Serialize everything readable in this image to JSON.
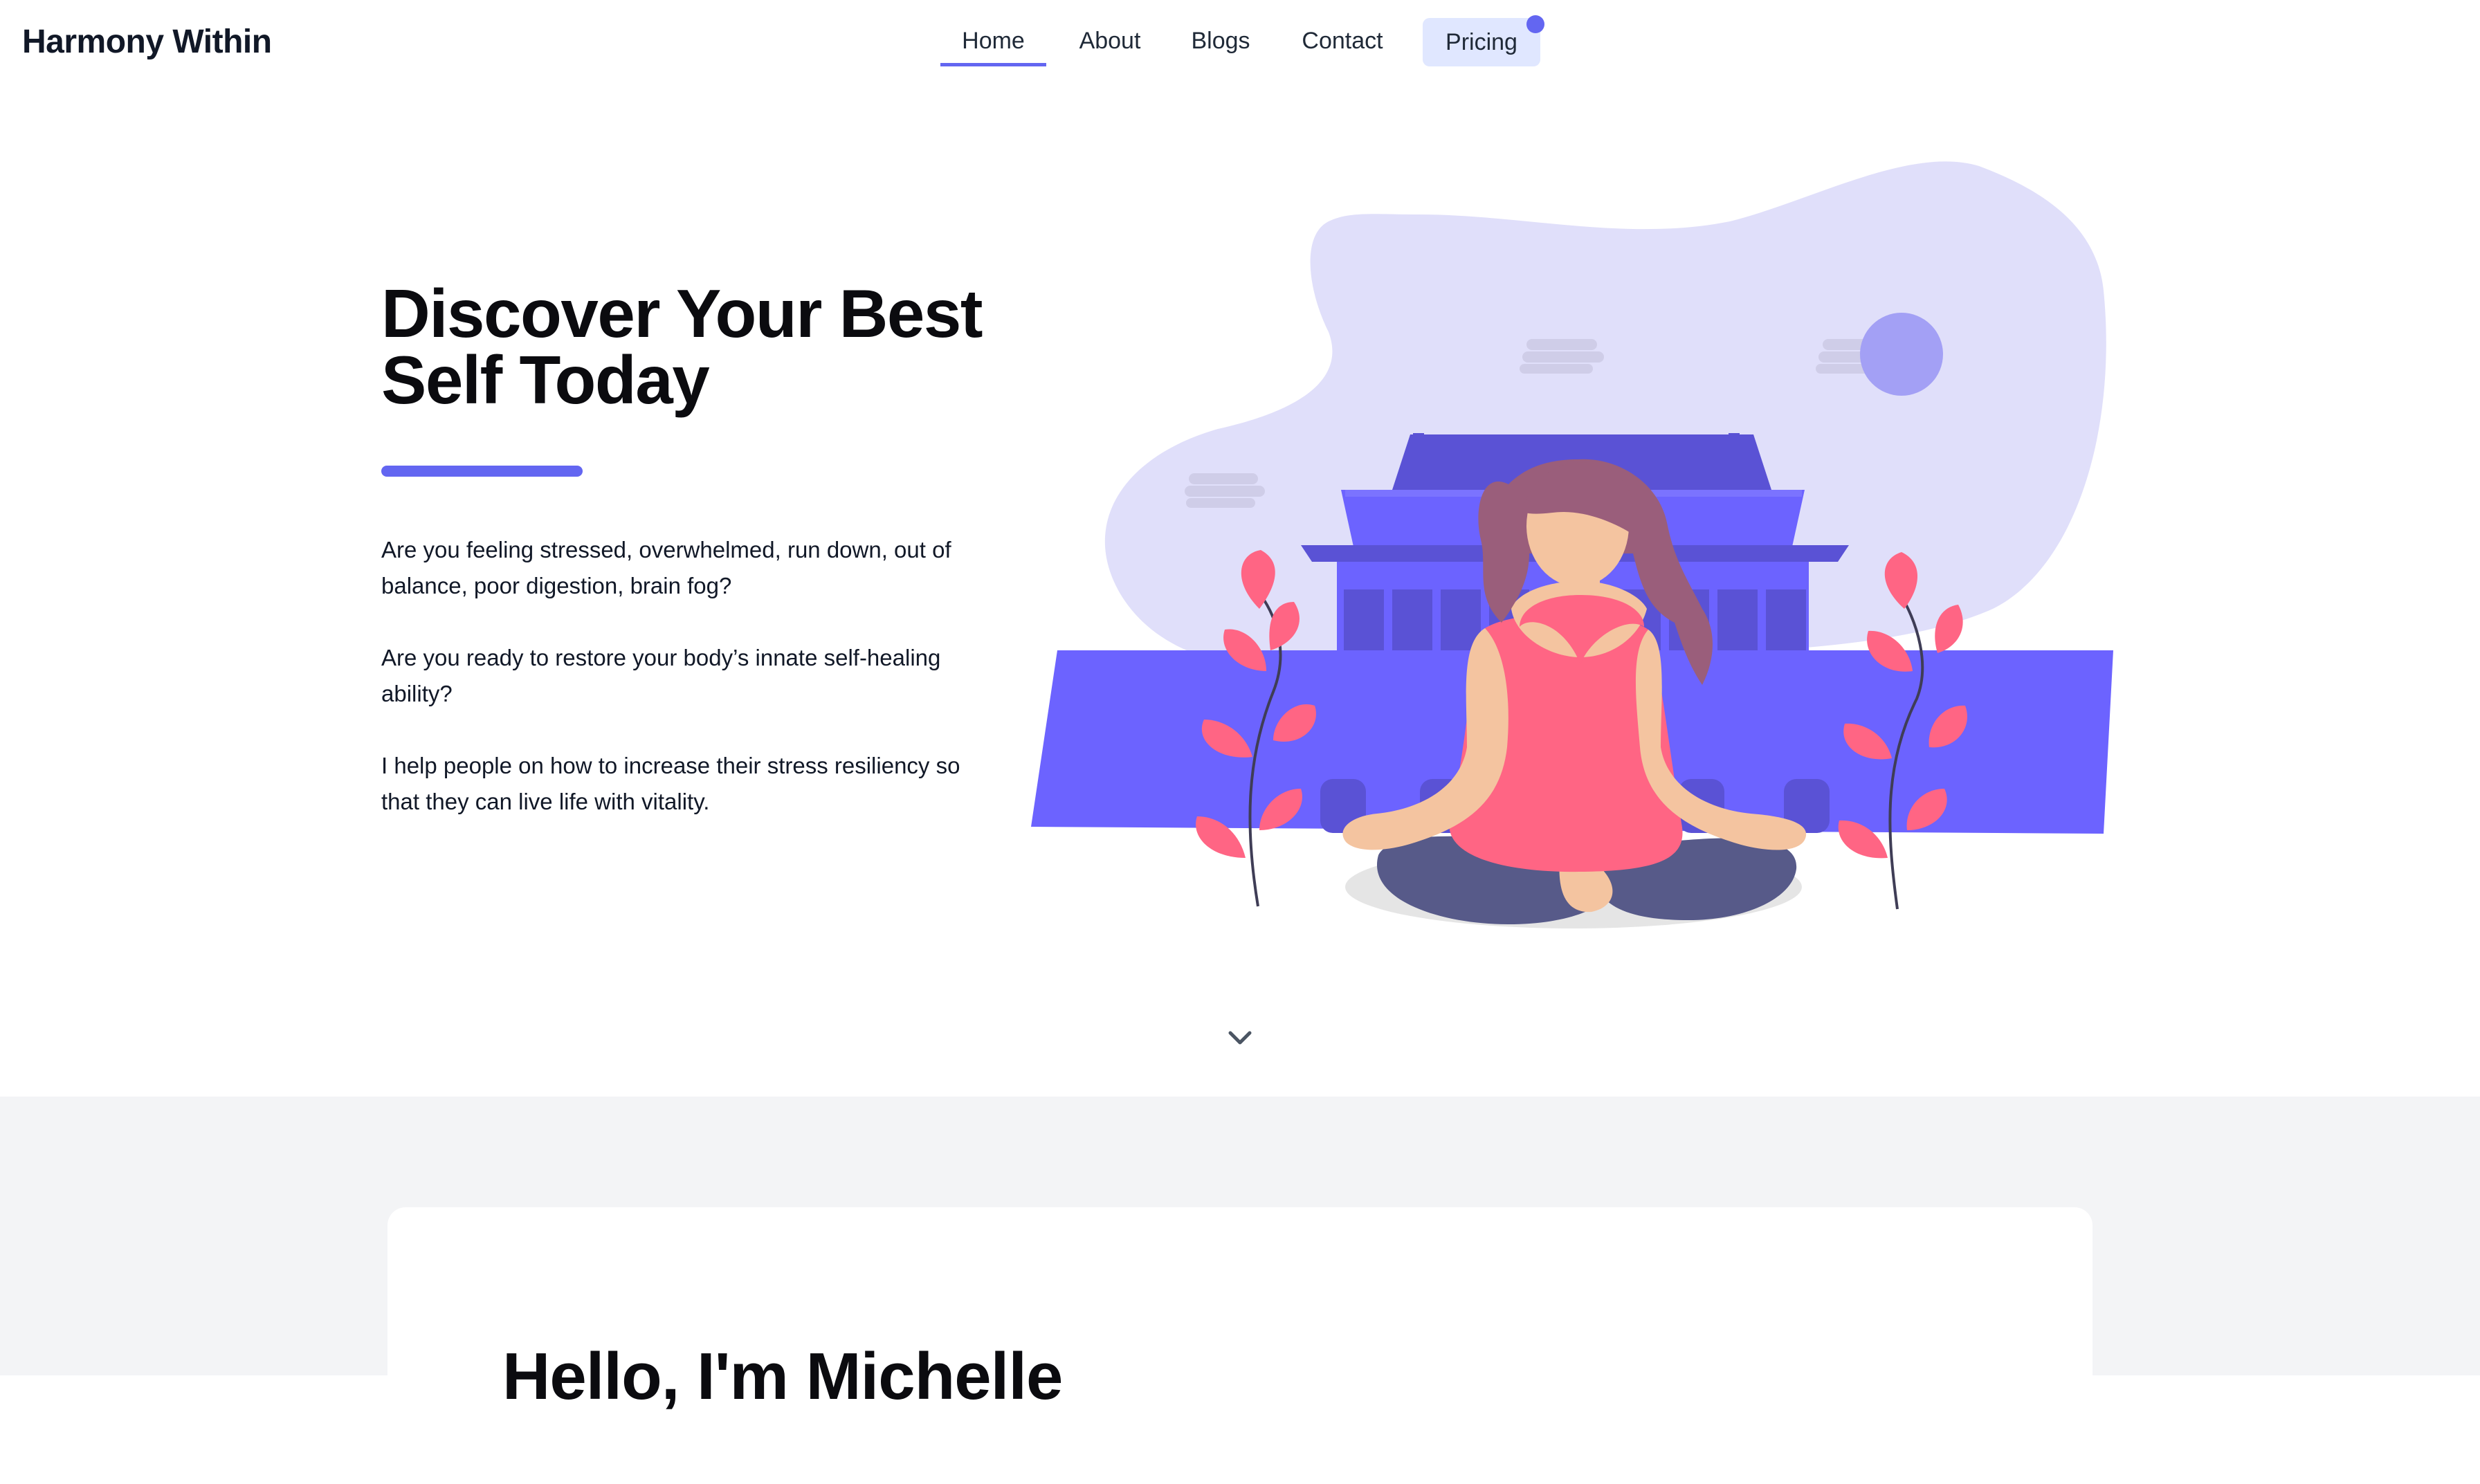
{
  "navbar": {
    "brand": "Harmony Within",
    "items": [
      {
        "label": "Home"
      },
      {
        "label": "About"
      },
      {
        "label": "Blogs"
      },
      {
        "label": "Contact"
      },
      {
        "label": "Pricing"
      }
    ],
    "active": "Home",
    "accent": "#6366f1",
    "pricing_bg": "#e0e7ff"
  },
  "hero": {
    "title": "Discover Your Best Self Today",
    "paragraphs": [
      "Are you feeling stressed, overwhelmed, run down, out of balance, poor digestion, brain fog?",
      "Are you ready to restore your body’s innate self-healing ability?",
      "I help people on how to increase their stress resiliency so that they can live life with vitality."
    ],
    "illustration": "meditation-woman-temple-illustration",
    "scroll_icon": "chevron-down-icon"
  },
  "about": {
    "title": "Hello, I'm Michelle",
    "background": "#f3f4f6"
  }
}
